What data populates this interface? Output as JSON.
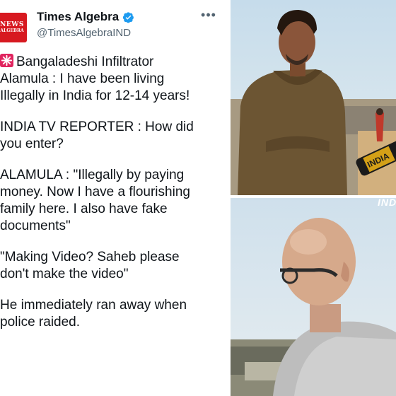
{
  "account": {
    "logo_line1": "NEWS",
    "logo_line2": "ALGEBRA",
    "name": "Times Algebra",
    "handle": "@TimesAlgebraIND",
    "verified_icon": "verified-badge-icon",
    "more_icon": "more-options-icon"
  },
  "tweet": {
    "icon": "siren-icon",
    "paragraphs": [
      "Bangaladeshi Infiltrator\nAlamula : I have been living\nIllegally in India for 12-14 years!",
      "INDIA TV REPORTER : How did\nyou enter?",
      "ALAMULA : \"Illegally by paying\nmoney. Now I have a flourishing\nfamily here. I also have fake\ndocuments\"",
      "\"Making Video? Saheb please\ndon't make the video\"",
      "He immediately ran away when\npolice raided."
    ]
  },
  "media": {
    "watermark": "INDI",
    "mic_flag": "INDIA"
  },
  "colors": {
    "brand_red": "#d71920",
    "verified_blue": "#1d9bf0",
    "text": "#0f1419",
    "muted": "#536471"
  }
}
